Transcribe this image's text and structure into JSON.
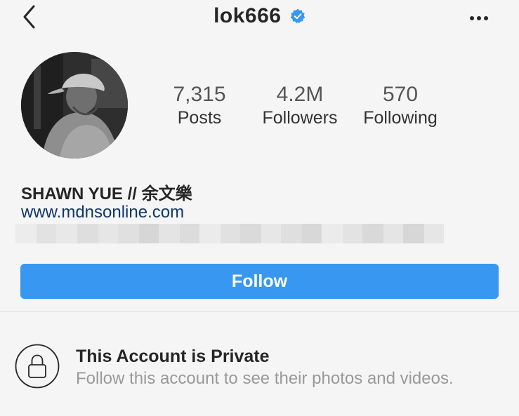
{
  "header": {
    "username": "lok666",
    "verified_icon": "verified-badge-icon",
    "back_icon": "chevron-left-icon",
    "more_icon": "more-dots-icon"
  },
  "stats": [
    {
      "value": "7,315",
      "label": "Posts"
    },
    {
      "value": "4.2M",
      "label": "Followers"
    },
    {
      "value": "570",
      "label": "Following"
    }
  ],
  "profile": {
    "name": "SHAWN YUE // 余文樂",
    "website": "www.mdnsonline.com"
  },
  "follow_button": {
    "label": "Follow"
  },
  "private": {
    "title": "This Account is Private",
    "subtitle": "Follow this account to see their photos and videos.",
    "icon": "lock-icon"
  },
  "colors": {
    "accent": "#3897f0",
    "link": "#10376b",
    "verified": "#3897f0",
    "muted_text": "#999999"
  }
}
